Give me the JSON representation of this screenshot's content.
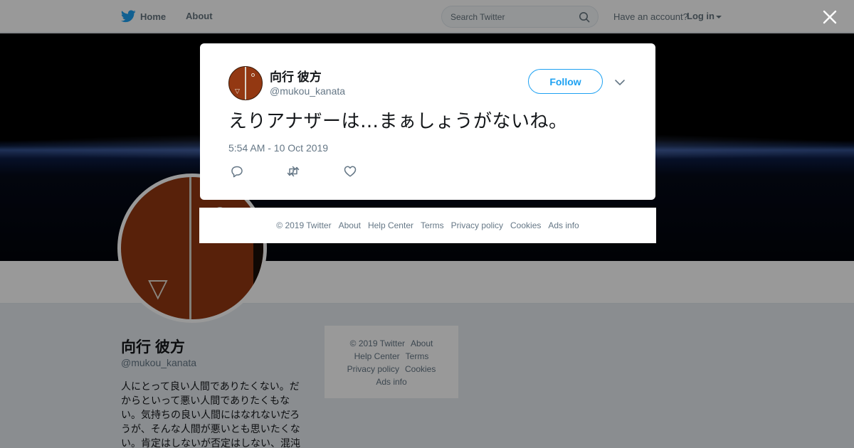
{
  "topbar": {
    "home_label": "Home",
    "about_label": "About",
    "search_placeholder": "Search Twitter",
    "account_prompt": "Have an account?",
    "login_label": "Log in"
  },
  "profile": {
    "name": "向行 彼方",
    "handle": "@mukou_kanata",
    "bio": "人にとって良い人間でありたくない。だからといって悪い人間でありたくもない。気持ちの良い人間にはなれないだろうが、そんな人間が悪いとも思いたくない。肯定はしないが否定はしない、混沌"
  },
  "side_footer": {
    "items": [
      "© 2019 Twitter",
      "About",
      "Help Center",
      "Terms",
      "Privacy policy",
      "Cookies",
      "Ads info"
    ]
  },
  "tweet": {
    "author_name": "向行 彼方",
    "author_handle": "@mukou_kanata",
    "follow_label": "Follow",
    "text": "えりアナザーは…まぁしょうがないね。",
    "timestamp": "5:54 AM - 10 Oct 2019"
  },
  "modal_footer": {
    "items": [
      "© 2019 Twitter",
      "About",
      "Help Center",
      "Terms",
      "Privacy policy",
      "Cookies",
      "Ads info"
    ]
  },
  "icons": {
    "logo": "twitter-bird-icon",
    "search": "search-icon",
    "close": "close-icon",
    "more": "chevron-down-icon",
    "reply": "reply-icon",
    "retweet": "retweet-icon",
    "like": "heart-icon"
  },
  "colors": {
    "accent": "#1da1f2",
    "avatar": "#933812",
    "muted_text": "#657786"
  }
}
